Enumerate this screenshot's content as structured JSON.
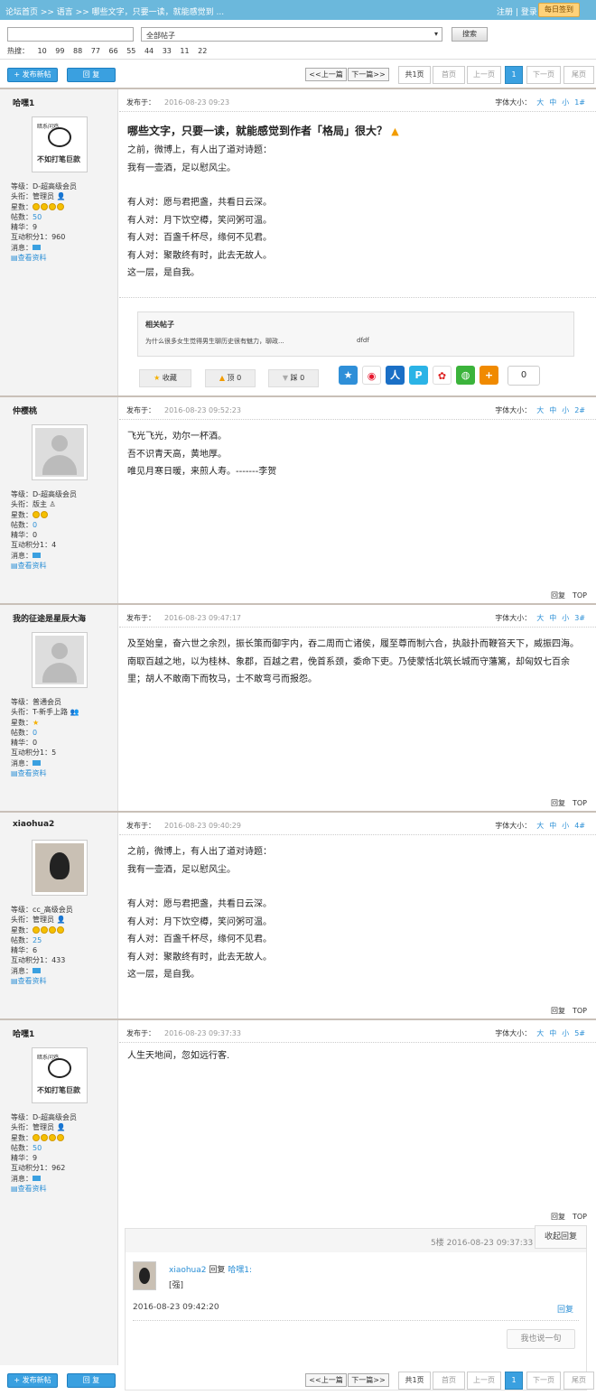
{
  "breadcrumb": "论坛首页 >> 语言 >> 哪些文字，只要一读，就能感觉到 ...",
  "auth": {
    "register": "注册",
    "sep": "|",
    "login": "登录"
  },
  "daily_sign": "每日签到",
  "search": {
    "input_value": "",
    "select_value": "全部帖子",
    "button": "搜索",
    "hot_label": "热搜：",
    "hot": [
      "10",
      "99",
      "88",
      "77",
      "66",
      "55",
      "44",
      "33",
      "11",
      "22"
    ]
  },
  "toolbar": {
    "new_post": "+ 发布新帖",
    "reply": "回 复",
    "prev_thread": "<<上一篇",
    "next_thread": "下一篇>>",
    "total": "共1页",
    "first": "首页",
    "prev": "上一页",
    "current": "1",
    "next": "下一页",
    "last": "尾页"
  },
  "posts": [
    {
      "author": "哈嘿1",
      "avatar": "meme",
      "meme_top": "暗系问鸡",
      "meme_bottom": "不如打笔巨款",
      "level": "等级：D-超高级会员",
      "title": "头衔：管理员",
      "stars": "星数：",
      "stars_count": 4,
      "posts_label": "帖数：",
      "posts_count": "50",
      "elite": "精华：9",
      "points": "互动积分1：960",
      "msg": "消息：",
      "profile": "查看资料",
      "posted_label": "发布于：",
      "date": "2016-08-23 09:23",
      "font_label": "字体大小：",
      "font_big": "大",
      "font_mid": "中",
      "font_small": "小",
      "floor": "1#",
      "heading": "哪些文字，只要一读，就能感觉到作者「格局」很大？",
      "lines": [
        "之前，微博上，有人出了道对诗题：",
        "我有一壶酒，足以慰风尘。",
        "",
        "有人对：愿与君把盏，共看日云深。",
        "有人对：月下饮空樽，笑问粥可温。",
        "有人对：百盏千杯尽，缘何不见君。",
        "有人对：聚散终有时，此去无故人。",
        "这一层，是自我。"
      ]
    },
    {
      "author": "仲樱桃",
      "avatar": "ghost",
      "level": "等级：D-超高级会员",
      "title": "头衔：版主",
      "stars": "星数：",
      "stars_count": 2,
      "posts_label": "帖数：",
      "posts_count": "0",
      "elite": "精华：0",
      "points": "互动积分1：4",
      "msg": "消息：",
      "profile": "查看资料",
      "posted_label": "发布于：",
      "date": "2016-08-23 09:52:23",
      "font_label": "字体大小：",
      "font_big": "大",
      "font_mid": "中",
      "font_small": "小",
      "floor": "2#",
      "lines": [
        "飞光飞光，劝尔一杯酒。",
        "吾不识青天高，黄地厚。",
        "唯见月寒日暖，来煎人寿。-------李贺"
      ],
      "reply": "回复",
      "top": "TOP"
    },
    {
      "author": "我的征途是星辰大海",
      "avatar": "ghost",
      "level": "等级：普通会员",
      "title": "头衔：T-新手上路",
      "stars": "星数：",
      "stars_count": 1,
      "posts_label": "帖数：",
      "posts_count": "0",
      "elite": "精华：0",
      "points": "互动积分1：5",
      "msg": "消息：",
      "profile": "查看资料",
      "posted_label": "发布于：",
      "date": "2016-08-23 09:47:17",
      "font_label": "字体大小：",
      "font_big": "大",
      "font_mid": "中",
      "font_small": "小",
      "floor": "3#",
      "lines": [
        "及至始皇，奋六世之余烈，振长策而御宇内，吞二周而亡诸侯，履至尊而制六合，执敲扑而鞭笞天下，威振四海。南取百越之地，以为桂林、象郡，百越之君，俛首系颈，委命下吏。乃使蒙恬北筑长城而守藩篱，却匈奴七百余里；胡人不敢南下而牧马，士不敢弯弓而报怨。"
      ],
      "reply": "回复",
      "top": "TOP"
    },
    {
      "author": "xiaohua2",
      "avatar": "photo",
      "level": "等级：cc_高级会员",
      "title": "头衔：管理员",
      "stars": "星数：",
      "stars_count": 4,
      "posts_label": "帖数：",
      "posts_count": "25",
      "elite": "精华：6",
      "points": "互动积分1：433",
      "msg": "消息：",
      "profile": "查看资料",
      "posted_label": "发布于：",
      "date": "2016-08-23 09:40:29",
      "font_label": "字体大小：",
      "font_big": "大",
      "font_mid": "中",
      "font_small": "小",
      "floor": "4#",
      "lines": [
        "之前，微博上，有人出了道对诗题：",
        "我有一壶酒，足以慰风尘。",
        "",
        "有人对：愿与君把盏，共看日云深。",
        "有人对：月下饮空樽，笑问粥可温。",
        "有人对：百盏千杯尽，缘何不见君。",
        "有人对：聚散终有时，此去无故人。",
        "这一层，是自我。"
      ],
      "reply": "回复",
      "top": "TOP"
    },
    {
      "author": "哈嘿1",
      "avatar": "meme",
      "meme_top": "暗系问鸡",
      "meme_bottom": "不如打笔巨款",
      "level": "等级：D-超高级会员",
      "title": "头衔：管理员",
      "stars": "星数：",
      "stars_count": 4,
      "posts_label": "帖数：",
      "posts_count": "50",
      "elite": "精华：9",
      "points": "互动积分1：962",
      "msg": "消息：",
      "profile": "查看资料",
      "posted_label": "发布于：",
      "date": "2016-08-23 09:37:33",
      "font_label": "字体大小：",
      "font_big": "大",
      "font_mid": "中",
      "font_small": "小",
      "floor": "5#",
      "lines": [
        "人生天地间，忽如远行客."
      ],
      "reply": "回复",
      "top": "TOP"
    }
  ],
  "related": {
    "heading": "相关帖子",
    "link": "为什么很多女生觉得男生聊历史很有魅力，聊政...",
    "right": "dfdf"
  },
  "actions": {
    "fav": "收藏",
    "up": "顶 0",
    "down": "踩 0"
  },
  "share_count": "0",
  "subreply": {
    "time": "5楼 2016-08-23 09:37:33",
    "fold": "收起回复",
    "user": "xiaohua2",
    "verb": " 回复 ",
    "target": "哈嘿1:",
    "quote": "[强]",
    "date": "2016-08-23 09:42:20",
    "reply": "回复",
    "say": "我也说一句"
  }
}
